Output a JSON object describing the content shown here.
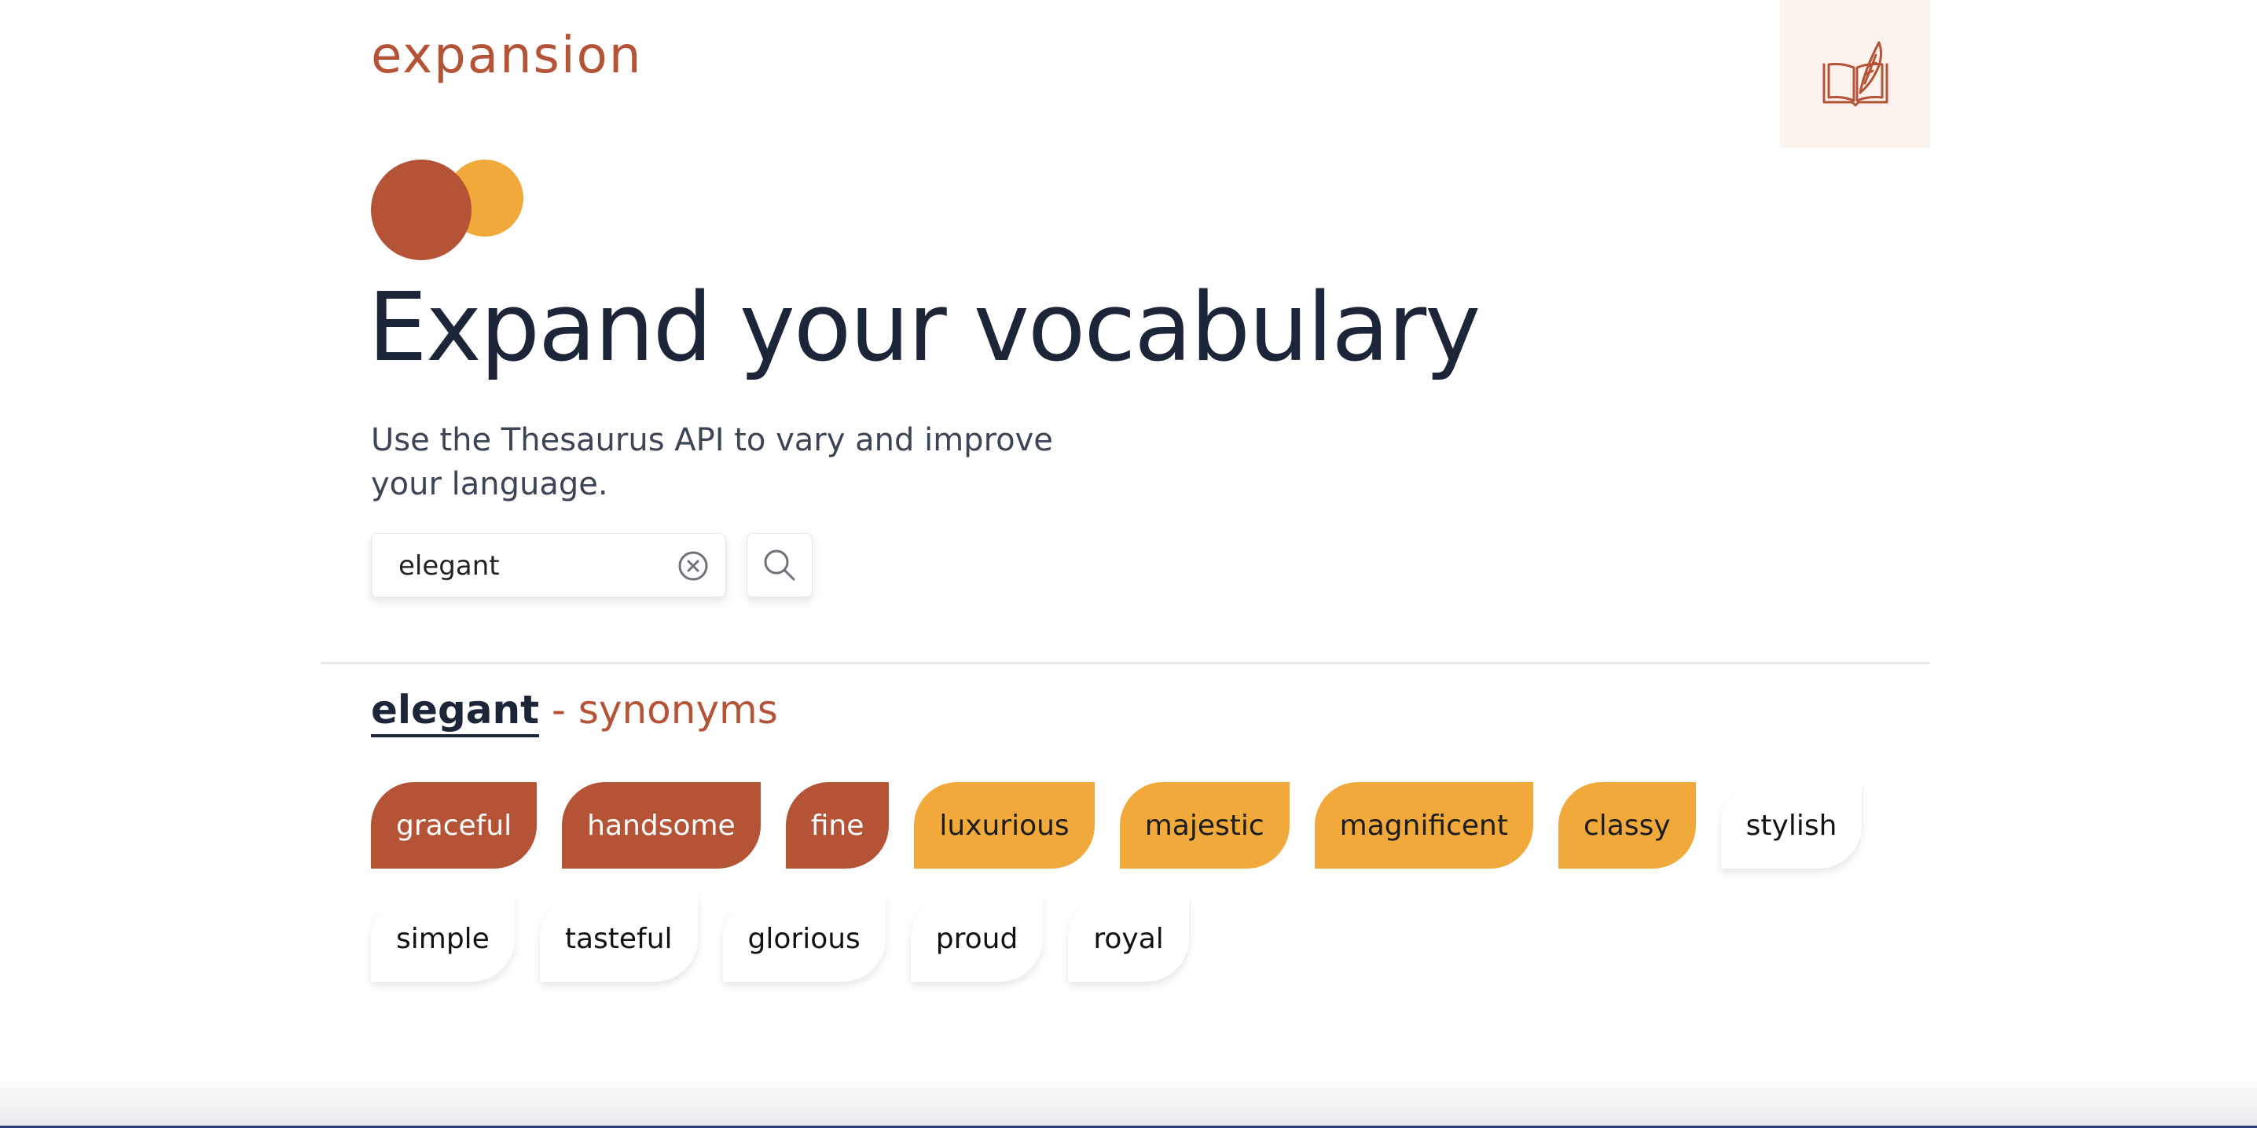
{
  "header": {
    "brand": "expansion",
    "book_icon": "book-quill-icon"
  },
  "hero": {
    "logo_colors": [
      "#b45336",
      "#f1a93b"
    ],
    "title": "Expand your vocabulary",
    "subtitle": "Use the Thesaurus API to vary and improve your language."
  },
  "search": {
    "value": "elegant",
    "clear_icon": "clear-circle-icon",
    "search_icon": "search-icon"
  },
  "results": {
    "word": "elegant",
    "suffix": "- synonyms",
    "synonyms": [
      {
        "label": "graceful",
        "tier": "strong"
      },
      {
        "label": "handsome",
        "tier": "strong"
      },
      {
        "label": "fine",
        "tier": "strong"
      },
      {
        "label": "luxurious",
        "tier": "medium"
      },
      {
        "label": "majestic",
        "tier": "medium"
      },
      {
        "label": "magnificent",
        "tier": "medium"
      },
      {
        "label": "classy",
        "tier": "medium"
      },
      {
        "label": "stylish",
        "tier": "weak"
      },
      {
        "label": "simple",
        "tier": "weak"
      },
      {
        "label": "tasteful",
        "tier": "weak"
      },
      {
        "label": "glorious",
        "tier": "weak"
      },
      {
        "label": "proud",
        "tier": "weak"
      },
      {
        "label": "royal",
        "tier": "weak"
      }
    ]
  },
  "colors": {
    "accent": "#b45336",
    "secondary": "#f1a93b",
    "text_dark": "#1c2638"
  }
}
